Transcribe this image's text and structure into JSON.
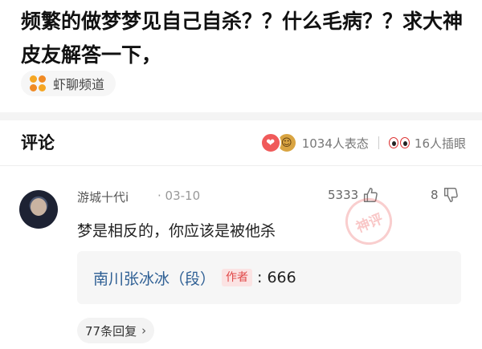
{
  "post": {
    "title": "频繁的做梦梦见自己自杀？？什么毛病？？求大神皮友解答一下，",
    "channel": "虾聊频道"
  },
  "comments_header": {
    "title": "评论",
    "reaction_count": "1034人表态",
    "peek_count": "16人插眼"
  },
  "comment": {
    "username": "游城十代i",
    "date": "03-10",
    "likes": "5333",
    "dislikes": "8",
    "text": "梦是相反的，你应该是被他杀",
    "stamp_text": "神评",
    "reply": {
      "author": "南川张冰冰（段）",
      "badge": "作者",
      "text": ": 666"
    },
    "replies_label": "77条回复"
  },
  "colors": {
    "author_link": "#2e5f94",
    "badge_text": "#e04848",
    "badge_bg": "#fbe3e3",
    "channel_icon": "#f5a623"
  },
  "icons": [
    "channel-icon",
    "like-reaction-icon",
    "laugh-reaction-icon",
    "eyes-icon",
    "thumb-up-icon",
    "thumb-down-icon",
    "chevron-right-icon"
  ]
}
